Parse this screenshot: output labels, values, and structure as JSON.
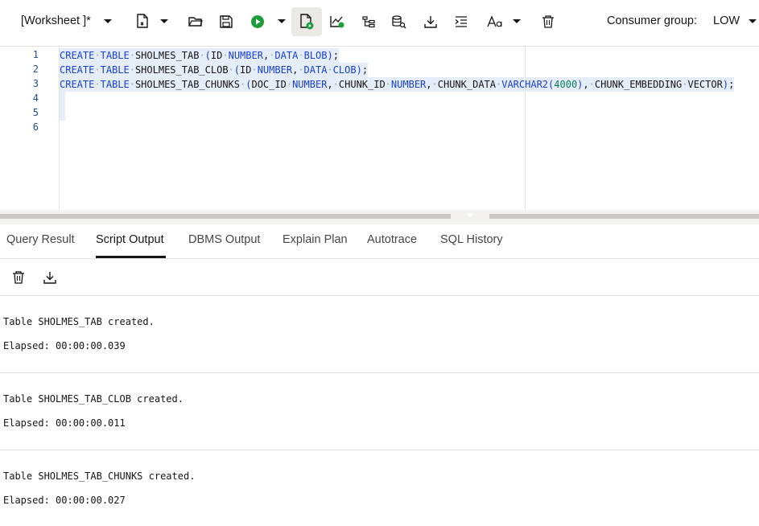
{
  "toolbar": {
    "worksheet_title": "[Worksheet ]*",
    "consumer_group_label": "Consumer group:",
    "consumer_group_value": "LOW",
    "icons": [
      "new-worksheet-icon",
      "open-icon",
      "save-icon",
      "run-statement-icon",
      "run-script-icon",
      "explain-plan-icon",
      "autotrace-icon",
      "sql-tuning-icon",
      "download-icon",
      "format-icon",
      "text-case-icon",
      "clear-icon"
    ]
  },
  "editor": {
    "line_numbers": [
      "1",
      "2",
      "3",
      "4",
      "5",
      "6"
    ],
    "lines": [
      {
        "tokens": [
          [
            "kw",
            "CREATE"
          ],
          [
            "sp",
            "·"
          ],
          [
            "kw",
            "TABLE"
          ],
          [
            "sp",
            "·"
          ],
          [
            "tx",
            "SHOLMES_TAB"
          ],
          [
            "sp",
            "·"
          ],
          [
            "kw",
            "("
          ],
          [
            "tx",
            "ID"
          ],
          [
            "sp",
            "·"
          ],
          [
            "kw",
            "NUMBER"
          ],
          [
            "tx",
            ","
          ],
          [
            "sp",
            "·"
          ],
          [
            "kw",
            "DATA"
          ],
          [
            "sp",
            "·"
          ],
          [
            "kw",
            "BLOB"
          ],
          [
            "kw",
            ")"
          ],
          [
            "tx",
            ";"
          ]
        ]
      },
      {
        "tokens": [
          [
            "kw",
            "CREATE"
          ],
          [
            "sp",
            "·"
          ],
          [
            "kw",
            "TABLE"
          ],
          [
            "sp",
            "·"
          ],
          [
            "tx",
            "SHOLMES_TAB_CLOB"
          ],
          [
            "sp",
            "·"
          ],
          [
            "kw",
            "("
          ],
          [
            "tx",
            "ID"
          ],
          [
            "sp",
            "·"
          ],
          [
            "kw",
            "NUMBER"
          ],
          [
            "tx",
            ","
          ],
          [
            "sp",
            "·"
          ],
          [
            "kw",
            "DATA"
          ],
          [
            "sp",
            "·"
          ],
          [
            "kw",
            "CLOB"
          ],
          [
            "kw",
            ")"
          ],
          [
            "tx",
            ";"
          ]
        ]
      },
      {
        "tokens": [
          [
            "kw",
            "CREATE"
          ],
          [
            "sp",
            "·"
          ],
          [
            "kw",
            "TABLE"
          ],
          [
            "sp",
            "·"
          ],
          [
            "tx",
            "SHOLMES_TAB_CHUNKS"
          ],
          [
            "sp",
            "·"
          ],
          [
            "kw",
            "("
          ],
          [
            "tx",
            "DOC_ID"
          ],
          [
            "sp",
            "·"
          ],
          [
            "kw",
            "NUMBER"
          ],
          [
            "tx",
            ","
          ],
          [
            "sp",
            "·"
          ],
          [
            "tx",
            "CHUNK_ID"
          ],
          [
            "sp",
            "·"
          ],
          [
            "kw",
            "NUMBER"
          ],
          [
            "tx",
            ","
          ],
          [
            "sp",
            "·"
          ],
          [
            "tx",
            "CHUNK_DATA"
          ],
          [
            "sp",
            "·"
          ],
          [
            "kw",
            "VARCHAR2"
          ],
          [
            "kw",
            "("
          ],
          [
            "num",
            "4000"
          ],
          [
            "kw",
            ")"
          ],
          [
            "tx",
            ","
          ],
          [
            "sp",
            "·"
          ],
          [
            "tx",
            "CHUNK_EMBEDDING"
          ],
          [
            "sp",
            "·"
          ],
          [
            "tx",
            "VECTOR"
          ],
          [
            "kw",
            ")"
          ],
          [
            "tx",
            ";"
          ]
        ]
      }
    ]
  },
  "tabs": [
    {
      "label": "Query Result",
      "name": "tab-query-result"
    },
    {
      "label": "Script Output",
      "name": "tab-script-output"
    },
    {
      "label": "DBMS Output",
      "name": "tab-dbms-output"
    },
    {
      "label": "Explain Plan",
      "name": "tab-explain-plan"
    },
    {
      "label": "Autotrace",
      "name": "tab-autotrace"
    },
    {
      "label": "SQL History",
      "name": "tab-sql-history"
    }
  ],
  "active_tab": "Script Output",
  "output": [
    {
      "message": "Table SHOLMES_TAB created.",
      "elapsed": "Elapsed: 00:00:00.039"
    },
    {
      "message": "Table SHOLMES_TAB_CLOB created.",
      "elapsed": "Elapsed: 00:00:00.011"
    },
    {
      "message": "Table SHOLMES_TAB_CHUNKS created.",
      "elapsed": "Elapsed: 00:00:00.027"
    }
  ],
  "colors": {
    "keyword": "#1a3fd6",
    "number": "#0b7d58",
    "selection": "#e4edf8",
    "run_green": "#1e9e3b"
  }
}
